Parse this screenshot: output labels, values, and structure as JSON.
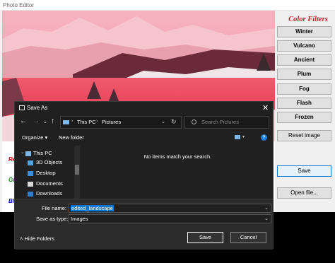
{
  "window": {
    "title": "Photo Editor"
  },
  "sidebar": {
    "title": "Color Filters",
    "filters": [
      {
        "label": "Winter"
      },
      {
        "label": "Vulcano"
      },
      {
        "label": "Ancient"
      },
      {
        "label": "Plum"
      },
      {
        "label": "Fog"
      },
      {
        "label": "Flash"
      },
      {
        "label": "Frozen"
      }
    ],
    "reset_label": "Reset image",
    "save_label": "Save",
    "open_label": "Open file..."
  },
  "side_labels": [
    "Re",
    "Gr",
    "Bl"
  ],
  "dialog": {
    "title": "Save As",
    "close_glyph": "✕",
    "breadcrumb": [
      "This PC",
      "Pictures"
    ],
    "search_placeholder": "Search Pictures",
    "organize_label": "Organize ▾",
    "new_folder_label": "New folder",
    "nav_items": [
      {
        "label": "This PC",
        "icon": "computer-icon"
      },
      {
        "label": "3D Objects",
        "icon": "cube-icon"
      },
      {
        "label": "Desktop",
        "icon": "desktop-icon"
      },
      {
        "label": "Documents",
        "icon": "document-icon"
      },
      {
        "label": "Downloads",
        "icon": "download-icon"
      }
    ],
    "empty_message": "No items match your search.",
    "file_name_label": "File name:",
    "file_name_value": "edited_landscape",
    "save_type_label": "Save as type:",
    "save_type_value": "Images",
    "hide_folders_label": "Hide Folders",
    "save_button": "Save",
    "cancel_button": "Cancel"
  },
  "colors": {
    "accent": "#0078d7",
    "filters_title": "#c0272d",
    "dialog_bg": "#202020"
  }
}
